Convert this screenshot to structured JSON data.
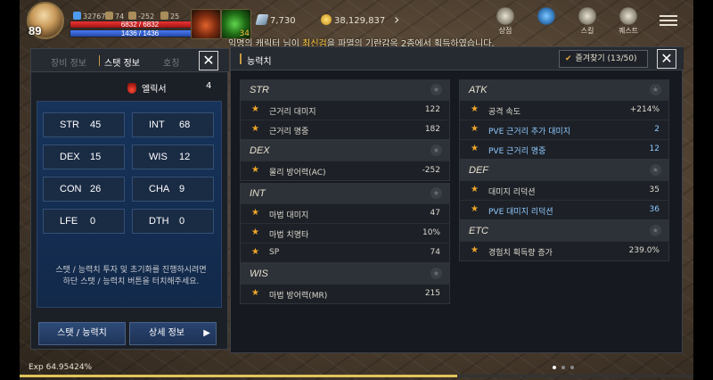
{
  "hud": {
    "level": "89",
    "chips": [
      {
        "icon": "gem-icon",
        "value": "32767"
      },
      {
        "icon": "key-icon",
        "value": "74"
      },
      {
        "icon": "lawful-icon",
        "value": "-252"
      },
      {
        "icon": "weight-icon",
        "value": "25"
      }
    ],
    "hp": "6832 / 6832",
    "hp_fraction": 1.0,
    "mp": "1436 / 1436",
    "mp_fraction": 1.0,
    "herb_count": "34",
    "silver": "7,730",
    "gold": "38,129,837",
    "menu": [
      {
        "icon": "shop-icon",
        "label": "상점"
      },
      {
        "icon": "event-icon",
        "label": ""
      },
      {
        "icon": "skill-icon",
        "label": "스킬"
      },
      {
        "icon": "quest-icon",
        "label": "퀘스트"
      }
    ]
  },
  "notice": {
    "prefix": "익명의 캐릭터 님이 ",
    "item": "최신검",
    "suffix": "을 파멸의 기란감옥 2층에서 획득하였습니다."
  },
  "left_panel": {
    "tabs": [
      "장비 정보",
      "스탯 정보",
      "호칭"
    ],
    "active_tab": 1,
    "elixir_label": "엘릭서",
    "elixir_count": "4",
    "stats": [
      {
        "name": "STR",
        "value": "45"
      },
      {
        "name": "INT",
        "value": "68"
      },
      {
        "name": "DEX",
        "value": "15"
      },
      {
        "name": "WIS",
        "value": "12"
      },
      {
        "name": "CON",
        "value": "26"
      },
      {
        "name": "CHA",
        "value": "9"
      },
      {
        "name": "LFE",
        "value": "0"
      },
      {
        "name": "DTH",
        "value": "0"
      }
    ],
    "hint_line1": "스탯 / 능력치 투자 및 초기화를 진행하시려면",
    "hint_line2": "하단 스탯 / 능력치 버튼을 터치해주세요.",
    "button_stat": "스탯 / 능력치",
    "button_detail": "상세 정보"
  },
  "right_panel": {
    "title": "능력치",
    "favorites_label": "즐겨찾기 (13/50)",
    "sections": [
      {
        "title": "STR",
        "rows": [
          {
            "label": "근거리 대미지",
            "value": "122",
            "blue": false
          },
          {
            "label": "근거리 명중",
            "value": "182",
            "blue": false
          }
        ]
      },
      {
        "title": "DEX",
        "rows": [
          {
            "label": "물리 방어력(AC)",
            "value": "-252",
            "blue": false
          }
        ]
      },
      {
        "title": "INT",
        "rows": [
          {
            "label": "마법 대미지",
            "value": "47",
            "blue": false
          },
          {
            "label": "마법 치명타",
            "value": "10%",
            "blue": false
          },
          {
            "label": "SP",
            "value": "74",
            "blue": false
          }
        ]
      },
      {
        "title": "WIS",
        "rows": [
          {
            "label": "마법 방어력(MR)",
            "value": "215",
            "blue": false
          }
        ]
      },
      {
        "title": "ATK",
        "rows": [
          {
            "label": "공격 속도",
            "value": "+214%",
            "blue": false
          },
          {
            "label": "PVE 근거리 추가 대미지",
            "value": "2",
            "blue": true
          },
          {
            "label": "PVE 근거리 명중",
            "value": "12",
            "blue": true
          }
        ]
      },
      {
        "title": "DEF",
        "rows": [
          {
            "label": "대미지 리덕션",
            "value": "35",
            "blue": false
          },
          {
            "label": "PVE 대미지 리덕션",
            "value": "36",
            "blue": true
          }
        ]
      },
      {
        "title": "ETC",
        "rows": [
          {
            "label": "경험치 획득량 증가",
            "value": "239.0%",
            "blue": false
          }
        ]
      }
    ]
  },
  "footer": {
    "exp_label": "Exp",
    "exp_value": "64.95424%",
    "exp_fraction": 0.6495424
  },
  "colors": {
    "star": "#f0a62a",
    "blue_text": "#8fc8ff",
    "hp": "#e33333",
    "mp": "#4b7cf2",
    "tab_accent": "#c79a43"
  }
}
